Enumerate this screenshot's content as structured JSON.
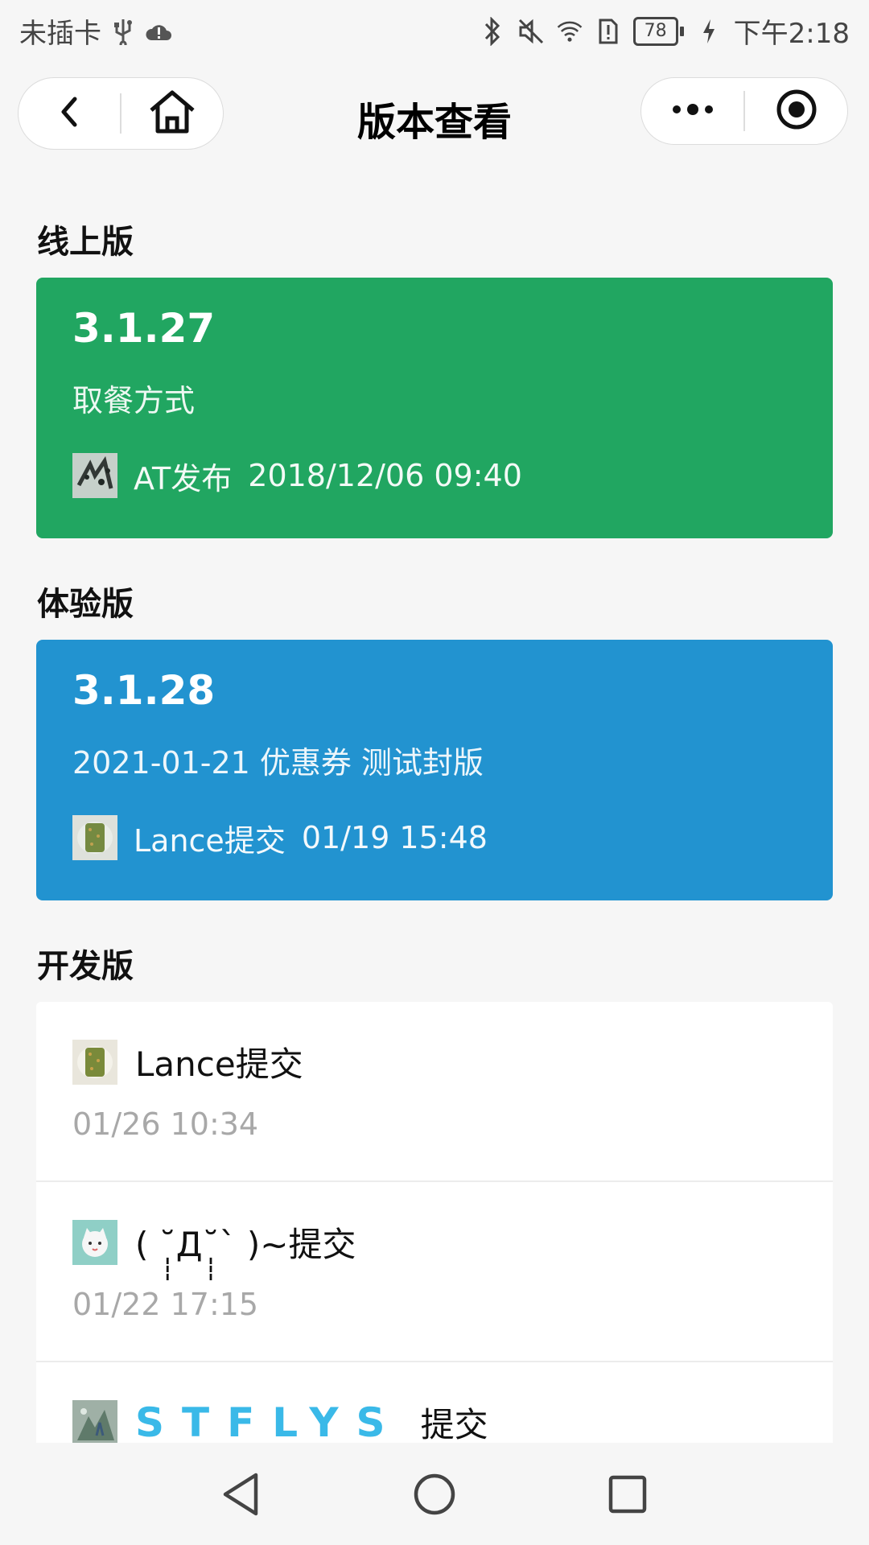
{
  "status_bar": {
    "carrier": "未插卡",
    "battery": "78",
    "time": "下午2:18"
  },
  "nav": {
    "title": "版本查看"
  },
  "sections": {
    "online": "线上版",
    "trial": "体验版",
    "dev": "开发版"
  },
  "online_card": {
    "version": "3.1.27",
    "description": "取餐方式",
    "publisher": "AT发布",
    "datetime": "2018/12/06 09:40",
    "color": "#21a661"
  },
  "trial_card": {
    "version": "3.1.28",
    "description": "2021-01-21 优惠券 测试封版",
    "submitter": "Lance提交",
    "datetime": "01/19 15:48",
    "color": "#2293d0"
  },
  "dev_items": [
    {
      "submitter": "Lance提交",
      "time": "01/26 10:34"
    },
    {
      "submitter": "( ˘̩̩̩Д˘̩̩̩` )~提交",
      "time": "01/22 17:15"
    },
    {
      "name_styled": "STFLYS",
      "suffix": "提交"
    }
  ]
}
